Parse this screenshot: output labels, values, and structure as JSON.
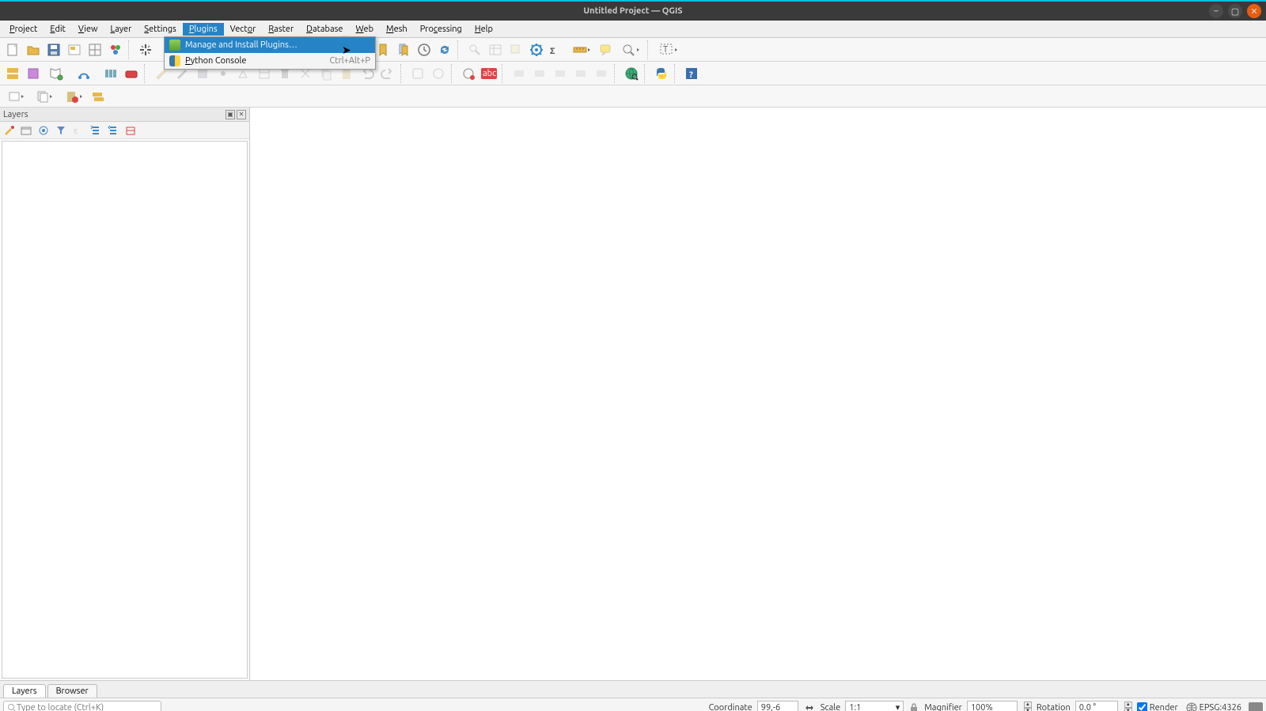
{
  "window": {
    "title": "Untitled Project — QGIS"
  },
  "menus": {
    "project": "Project",
    "edit": "Edit",
    "view": "View",
    "layer": "Layer",
    "settings": "Settings",
    "plugins": "Plugins",
    "vector": "Vector",
    "raster": "Raster",
    "database": "Database",
    "web": "Web",
    "mesh": "Mesh",
    "processing": "Processing",
    "help": "Help"
  },
  "plugins_menu": {
    "manage": "Manage and Install Plugins…",
    "python": "Python Console",
    "python_shortcut": "Ctrl+Alt+P"
  },
  "panels": {
    "layers_title": "Layers",
    "tab_layers": "Layers",
    "tab_browser": "Browser"
  },
  "status": {
    "locator_placeholder": "Type to locate (Ctrl+K)",
    "coord_label": "Coordinate",
    "coord_value": "99,-6",
    "scale_label": "Scale",
    "scale_value": "1:1",
    "magnifier_label": "Magnifier",
    "magnifier_value": "100%",
    "rotation_label": "Rotation",
    "rotation_value": "0.0 °",
    "render_label": "Render",
    "crs_label": "EPSG:4326"
  }
}
